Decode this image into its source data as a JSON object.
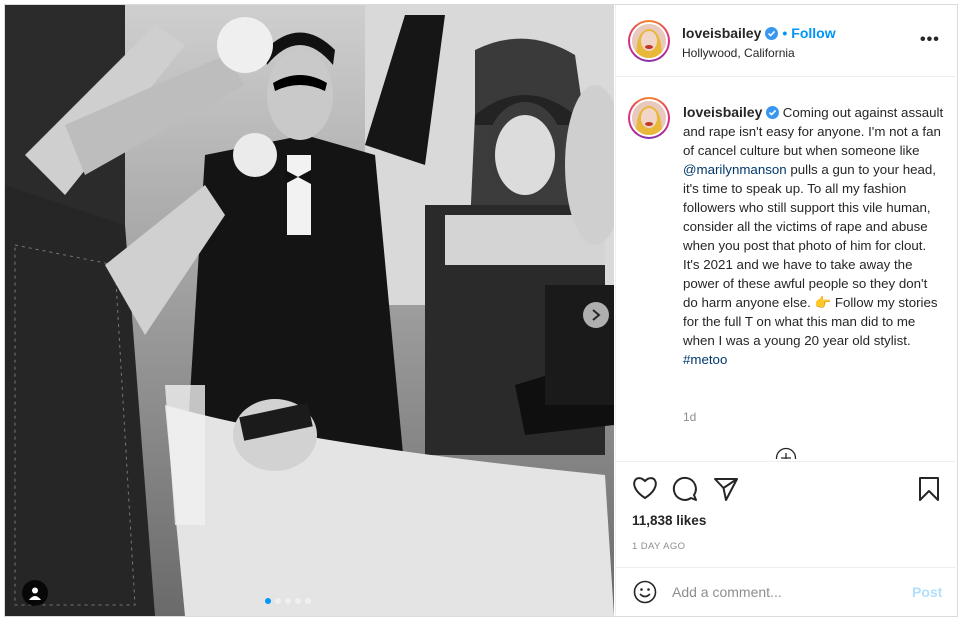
{
  "post": {
    "username": "loveisbailey",
    "follow_label": "Follow",
    "separator": "•",
    "location": "Hollywood, California",
    "more_label": "•••"
  },
  "caption": {
    "username": "loveisbailey",
    "part1": "Coming out against assault and rape isn't easy for anyone. I'm not a fan of cancel culture but when someone like ",
    "mention": "@marilynmanson",
    "part2": " pulls a gun to your head, it's time to speak up. To all my fashion followers who still support this vile human, consider all the victims of rape and abuse when you post that photo of him for clout. It's 2021 and we have to take away the power of these awful people so they don't do harm anyone else. ",
    "emoji": "👉",
    "part3": " Follow my stories for the full T on what this man did to me when I was a young 20 year old stylist.",
    "hashtag": "#metoo",
    "time_ago": "1d"
  },
  "engagement": {
    "likes": "11,838 likes",
    "date": "1 DAY AGO"
  },
  "comment": {
    "placeholder": "Add a comment...",
    "post_label": "Post"
  },
  "carousel": {
    "slides": 5,
    "active_index": 0
  },
  "icons": {
    "verified": "verified-badge-icon",
    "like": "heart-icon",
    "comment": "comment-icon",
    "share": "paper-plane-icon",
    "save": "bookmark-icon",
    "emoji": "smiley-icon",
    "next": "chevron-right-icon",
    "tagged": "user-tag-icon",
    "load_more": "plus-circle-icon"
  },
  "colors": {
    "accent": "#0095f6",
    "link": "#00376b",
    "muted": "#8e8e8e",
    "post_disabled": "#b2dffc"
  }
}
